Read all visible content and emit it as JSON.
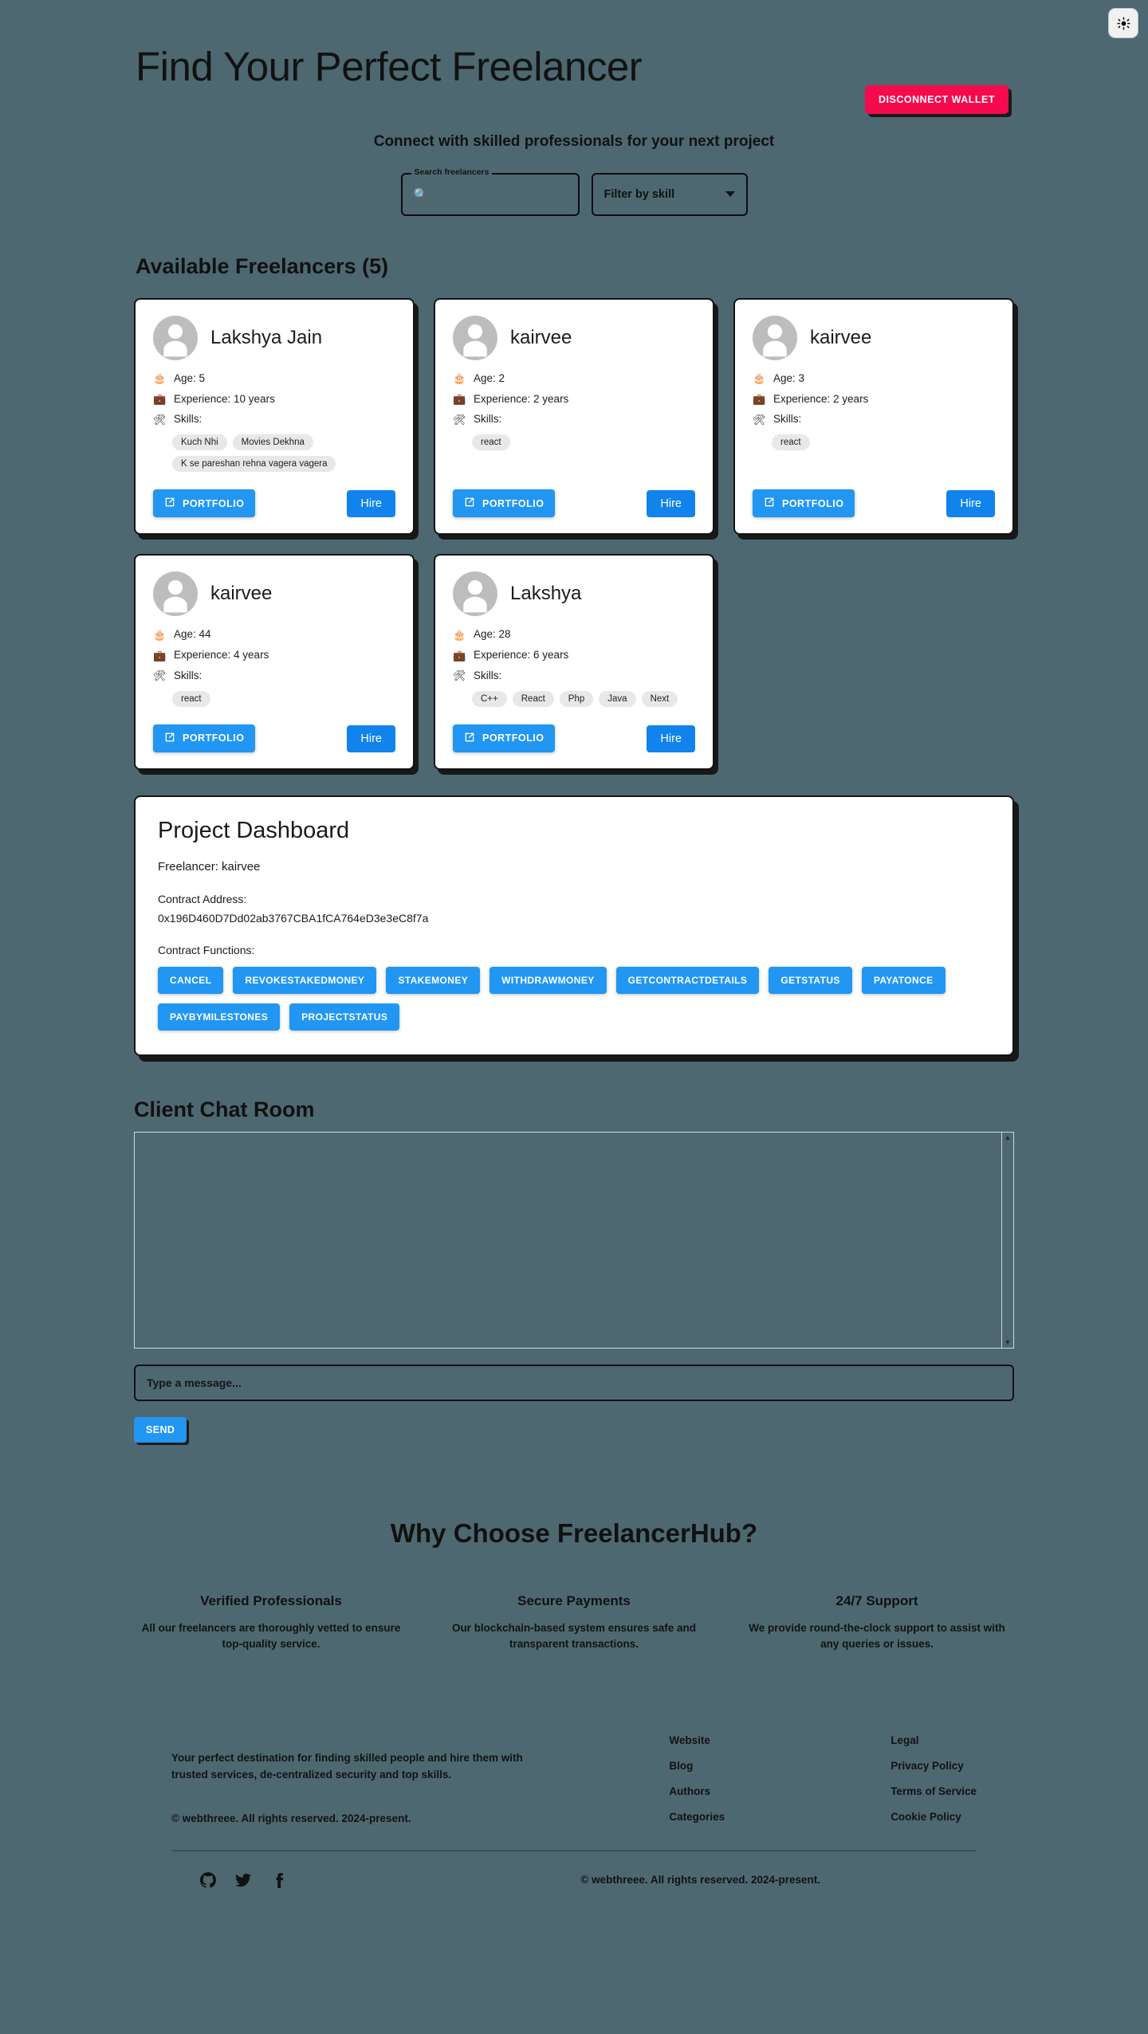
{
  "topbar": {
    "settings_icon": "gear-sun-icon"
  },
  "header": {
    "title": "Find Your Perfect Freelancer",
    "disconnect_label": "DISCONNECT WALLET",
    "subtitle": "Connect with skilled professionals for your next project"
  },
  "search": {
    "legend": "Search freelancers",
    "value": "",
    "placeholder": "",
    "icon": "search-icon",
    "filter_label": "Filter by skill"
  },
  "listing": {
    "heading": "Available Freelancers (5)",
    "count": 5,
    "labels": {
      "age_prefix": "Age: ",
      "experience_prefix": "Experience: ",
      "skills_label": "Skills:",
      "portfolio": "PORTFOLIO",
      "hire": "Hire"
    },
    "freelancers": [
      {
        "name": "Lakshya Jain",
        "age": "Age: 5",
        "experience": "Experience: 10 years",
        "skills_label": "Skills:",
        "skills": [
          "Kuch Nhi",
          "Movies Dekhna",
          "K se pareshan rehna vagera vagera"
        ],
        "portfolio": "PORTFOLIO",
        "hire": "Hire"
      },
      {
        "name": "kairvee",
        "age": "Age: 2",
        "experience": "Experience: 2 years",
        "skills_label": "Skills:",
        "skills": [
          "react"
        ],
        "portfolio": "PORTFOLIO",
        "hire": "Hire"
      },
      {
        "name": "kairvee",
        "age": "Age: 3",
        "experience": "Experience: 2 years",
        "skills_label": "Skills:",
        "skills": [
          "react"
        ],
        "portfolio": "PORTFOLIO",
        "hire": "Hire"
      },
      {
        "name": "kairvee",
        "age": "Age: 44",
        "experience": "Experience: 4 years",
        "skills_label": "Skills:",
        "skills": [
          "react"
        ],
        "portfolio": "PORTFOLIO",
        "hire": "Hire"
      },
      {
        "name": "Lakshya",
        "age": "Age: 28",
        "experience": "Experience: 6 years",
        "skills_label": "Skills:",
        "skills": [
          "C++",
          "React",
          "Php",
          "Java",
          "Next"
        ],
        "portfolio": "PORTFOLIO",
        "hire": "Hire"
      }
    ]
  },
  "dashboard": {
    "title": "Project Dashboard",
    "freelancer_line": "Freelancer: kairvee",
    "contract_address_label": "Contract Address:",
    "contract_address": "0x196D460D7Dd02ab3767CBA1fCA764eD3e3eC8f7a",
    "functions_label": "Contract Functions:",
    "functions": [
      "CANCEL",
      "REVOKESTAKEDMONEY",
      "STAKEMONEY",
      "WITHDRAWMONEY",
      "GETCONTRACTDETAILS",
      "GETSTATUS",
      "PAYATONCE",
      "PAYBYMILESTONES",
      "PROJECTSTATUS"
    ]
  },
  "chat": {
    "title": "Client Chat Room",
    "messages": [],
    "input_placeholder": "Type a message...",
    "input_value": "",
    "send_label": "SEND",
    "scroll_up": "▲",
    "scroll_down": "▼"
  },
  "why": {
    "title": "Why Choose FreelancerHub?",
    "items": [
      {
        "heading": "Verified Professionals",
        "text": "All our freelancers are thoroughly vetted to ensure top-quality service."
      },
      {
        "heading": "Secure Payments",
        "text": "Our blockchain-based system ensures safe and transparent transactions."
      },
      {
        "heading": "24/7 Support",
        "text": "We provide round-the-clock support to assist with any queries or issues."
      }
    ]
  },
  "footer": {
    "about": "Your perfect destination for finding skilled people and hire them with trusted services, de-centralized security and top skills.",
    "copyright": "© webthreee. All rights reserved. 2024-present.",
    "columns": [
      {
        "links": [
          "Website",
          "Blog",
          "Authors",
          "Categories"
        ]
      },
      {
        "links": [
          "Legal",
          "Privacy Policy",
          "Terms of Service",
          "Cookie Policy"
        ]
      }
    ],
    "socials": [
      "github-icon",
      "twitter-icon",
      "facebook-icon"
    ],
    "bottom_copyright": "© webthreee. All rights reserved. 2024-present."
  },
  "colors": {
    "background": "#4e6872",
    "accent_blue": "#2196f3",
    "hire_blue": "#1183ec",
    "danger_pink": "#f50a4d",
    "card_white": "#ffffff",
    "outline_black": "#141414",
    "chip_gray": "#e8e8e8"
  }
}
